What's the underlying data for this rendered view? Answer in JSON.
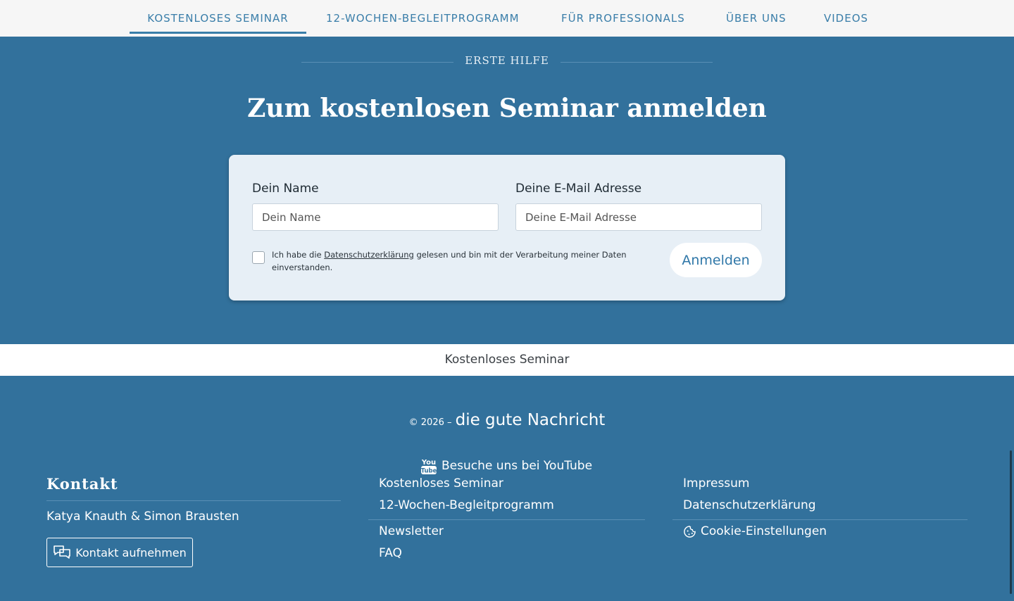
{
  "nav": {
    "items": [
      {
        "label": "KOSTENLOSES SEMINAR",
        "active": true
      },
      {
        "label": "12-WOCHEN-BEGLEITPROGRAMM",
        "active": false
      },
      {
        "label": "FÜR PROFESSIONALS",
        "active": false
      },
      {
        "label": "ÜBER UNS",
        "active": false
      },
      {
        "label": "VIDEOS",
        "active": false
      }
    ]
  },
  "hero": {
    "eyebrow": "ERSTE HILFE",
    "title": "Zum kostenlosen Seminar anmelden"
  },
  "form": {
    "name_label": "Dein Name",
    "name_placeholder": "Dein Name",
    "email_label": "Deine E-Mail Adresse",
    "email_placeholder": "Deine E-Mail Adresse",
    "consent_prefix": "Ich habe die ",
    "consent_link": "Datenschutzerklärung",
    "consent_suffix": " gelesen und bin mit der Verarbeitung meiner Daten einverstanden.",
    "submit_label": "Anmelden"
  },
  "breadcrumb": {
    "label": "Kostenloses Seminar"
  },
  "footer": {
    "copyright_prefix": "© 2026 –",
    "brand": "die gute Nachricht",
    "youtube_label": "Besuche uns bei YouTube",
    "contact": {
      "title": "Kontakt",
      "names": "Katya Knauth & Simon Brausten",
      "button_label": "Kontakt aufnehmen"
    },
    "links_middle": [
      "Kostenloses Seminar",
      "12-Wochen-Begleitprogramm",
      "Newsletter",
      "FAQ"
    ],
    "links_right": [
      "Impressum",
      "Datenschutzerklärung"
    ],
    "cookie_label": "Cookie-Einstellungen"
  },
  "colors": {
    "background": "#32719c",
    "nav_background": "#f6f6f6",
    "accent": "#3a7ea9",
    "card_background": "#e7eff6"
  }
}
